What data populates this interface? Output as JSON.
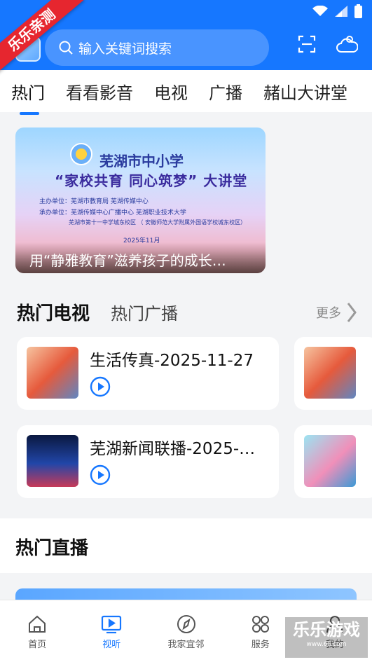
{
  "header": {
    "ribbon": "乐乐亲测",
    "search_placeholder": "输入关键词搜索"
  },
  "tabs": [
    {
      "label": "热门",
      "active": true
    },
    {
      "label": "看看影音"
    },
    {
      "label": "电视"
    },
    {
      "label": "广播"
    },
    {
      "label": "赭山大讲堂"
    }
  ],
  "banner": {
    "title_line1": "芜湖市中小学",
    "title_line2": "“家校共育 同心筑梦” 大讲堂",
    "organizer": "主办单位：芜湖市教育局 芜湖传媒中心",
    "co_organizer": "承办单位：芜湖传媒中心广播中心 芜湖职业技术大学",
    "venue": "芜湖市第十一中学城东校区 （ 安徽师范大学附属外国语学校城东校区）",
    "date": "2025年11月",
    "caption": "用“静雅教育”滋养孩子的成长…"
  },
  "hot_section": {
    "title": "热门电视",
    "subtitle": "热门广播",
    "more": "更多",
    "items": [
      {
        "title": "生活传真-2025-11-27"
      },
      {
        "title": "芜湖新闻联播-2025-…"
      }
    ]
  },
  "live_section": {
    "title": "热门直播"
  },
  "bottom_nav": [
    {
      "label": "首页",
      "icon": "home-icon"
    },
    {
      "label": "视听",
      "icon": "play-screen-icon",
      "active": true
    },
    {
      "label": "我家宜邻",
      "icon": "compass-icon"
    },
    {
      "label": "服务",
      "icon": "grid-icon"
    },
    {
      "label": "我的",
      "icon": "user-icon"
    }
  ],
  "watermark": {
    "text": "乐乐游戏",
    "url": "www.6ll.com"
  },
  "colors": {
    "brand": "#1677ff",
    "ribbon": "#e6262f"
  }
}
